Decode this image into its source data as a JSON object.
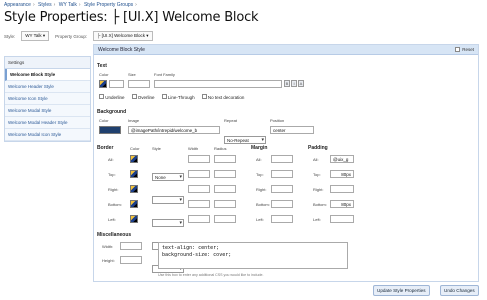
{
  "breadcrumb": [
    "Appearance",
    "Styles",
    "WY Talk",
    "Style Property Groups"
  ],
  "page_title": "Style Properties: ├ [UI.X] Welcome Block",
  "selectors": {
    "style_label": "Style:",
    "style_value": "WY Talk",
    "group_label": "Property Group:",
    "group_value": "├ [UI.X] Welcome Block"
  },
  "sidebar": {
    "header": "Settings",
    "items": [
      {
        "label": "Welcome Block Style",
        "active": true
      },
      {
        "label": "Welcome Header Style",
        "active": false
      },
      {
        "label": "Welcome Icon Style",
        "active": false
      },
      {
        "label": "Welcome Modal Style",
        "active": false
      },
      {
        "label": "Welcome Modal Header Style",
        "active": false
      },
      {
        "label": "Welcome Modal Icon Style",
        "active": false
      }
    ]
  },
  "panel": {
    "title": "Welcome Block Style",
    "reset_label": "Reset",
    "text_section": {
      "title": "Text",
      "color_label": "Color",
      "size_label": "Size",
      "family_label": "Font Family",
      "checkboxes": [
        "Underline",
        "Overline",
        "Line-Through",
        "No text decoration"
      ]
    },
    "background_section": {
      "title": "Background",
      "color_label": "Color",
      "image_label": "Image",
      "image_value": "@imagePath/intrepid/welcome_b",
      "repeat_label": "Repeat",
      "repeat_value": "No-Repeat",
      "position_label": "Position",
      "position_value": "center"
    },
    "border_section": {
      "title": "Border",
      "color_label": "Color",
      "style_label": "Style",
      "width_label": "Width",
      "radius_label": "Radius",
      "rows": [
        "All:",
        "Top:",
        "Right:",
        "Bottom:",
        "Left:"
      ],
      "all_style_value": "None"
    },
    "margin_section": {
      "title": "Margin",
      "rows": [
        "All:",
        "Top:",
        "Right:",
        "Bottom:",
        "Left:"
      ]
    },
    "padding_section": {
      "title": "Padding",
      "rows": [
        "All:",
        "Top:",
        "Right:",
        "Bottom:",
        "Left:"
      ],
      "values": [
        "@uix_g",
        "80px",
        "",
        "80px",
        ""
      ]
    },
    "misc_section": {
      "title": "Miscellaneous",
      "width_label": "Width:",
      "height_label": "Height:",
      "css_value": "text-align: center;\nbackground-size: cover;",
      "hint": "Use this box to enter any additional CSS you would like to include."
    }
  },
  "buttons": {
    "update": "Update Style Properties",
    "undo": "Undo Changes"
  }
}
